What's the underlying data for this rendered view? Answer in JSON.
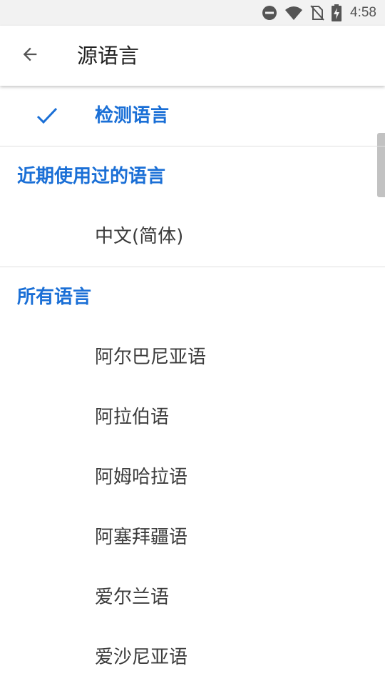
{
  "status_bar": {
    "time": "4:58",
    "icons": [
      "do-not-disturb-icon",
      "wifi-icon",
      "no-sim-icon",
      "battery-charging-icon"
    ]
  },
  "app_bar": {
    "back_icon": "arrow-back-icon",
    "title": "源语言"
  },
  "detect_option": {
    "label": "检测语言",
    "selected": true,
    "icon": "check-icon"
  },
  "recent_section": {
    "header": "近期使用过的语言",
    "items": [
      {
        "label": "中文(简体)"
      }
    ]
  },
  "all_section": {
    "header": "所有语言",
    "items": [
      {
        "label": "阿尔巴尼亚语"
      },
      {
        "label": "阿拉伯语"
      },
      {
        "label": "阿姆哈拉语"
      },
      {
        "label": "阿塞拜疆语"
      },
      {
        "label": "爱尔兰语"
      },
      {
        "label": "爱沙尼亚语"
      }
    ]
  },
  "colors": {
    "accent": "#1a6fd6",
    "text": "#3c3c3c",
    "title": "#222222",
    "status_bar_bg": "#f2f2f2",
    "divider": "#e0e0e0"
  }
}
